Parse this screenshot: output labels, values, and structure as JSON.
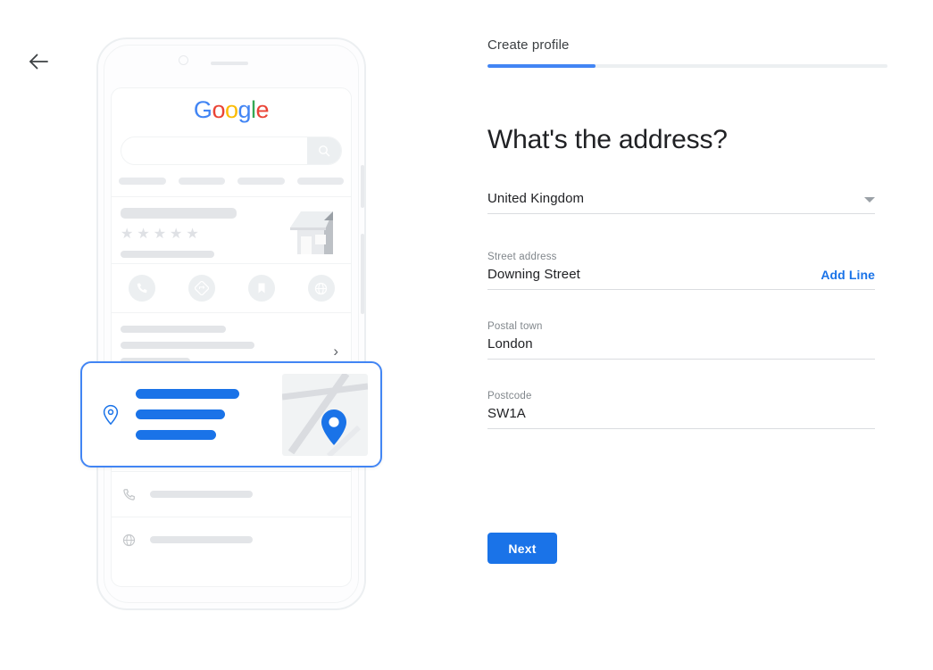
{
  "nav": {
    "back_icon": "arrow-left-icon"
  },
  "form": {
    "step_label": "Create profile",
    "progress_percent": 27,
    "title": "What's the address?",
    "fields": [
      {
        "key": "country",
        "label": "",
        "value": "United Kingdom",
        "icon": "chevron-down-icon",
        "action": ""
      },
      {
        "key": "street",
        "label": "Street address",
        "value": "Downing Street",
        "action": "Add Line"
      },
      {
        "key": "town",
        "label": "Postal town",
        "value": "London",
        "action": ""
      },
      {
        "key": "postcode",
        "label": "Postcode",
        "value": "SW1A",
        "action": ""
      }
    ],
    "next_label": "Next",
    "colors": {
      "accent": "#1a73e8",
      "progress": "#4285f4",
      "label": "#80868b",
      "value": "#202124",
      "underline": "#dadce0"
    }
  },
  "illustration": {
    "name": "phone-mockup",
    "google_logo": {
      "letters": [
        "G",
        "o",
        "o",
        "g",
        "l",
        "e"
      ],
      "colors": [
        "#4285f4",
        "#ea4335",
        "#fbbc05",
        "#4285f4",
        "#34a853",
        "#ea4335"
      ]
    },
    "search_icon": "search-icon",
    "stars": "★★★★★",
    "action_icons": [
      "phone-icon",
      "directions-icon",
      "bookmark-icon",
      "globe-icon"
    ],
    "chevron_icon": "chevron-right-icon",
    "info_row_icons": [
      "clock-icon",
      "phone-icon",
      "globe-icon"
    ],
    "address_card": {
      "pin_icon": "location-pin-icon",
      "map_pin_icon": "map-pin-icon",
      "highlight_color": "#4285f4",
      "line_color": "#1a73e8"
    }
  }
}
